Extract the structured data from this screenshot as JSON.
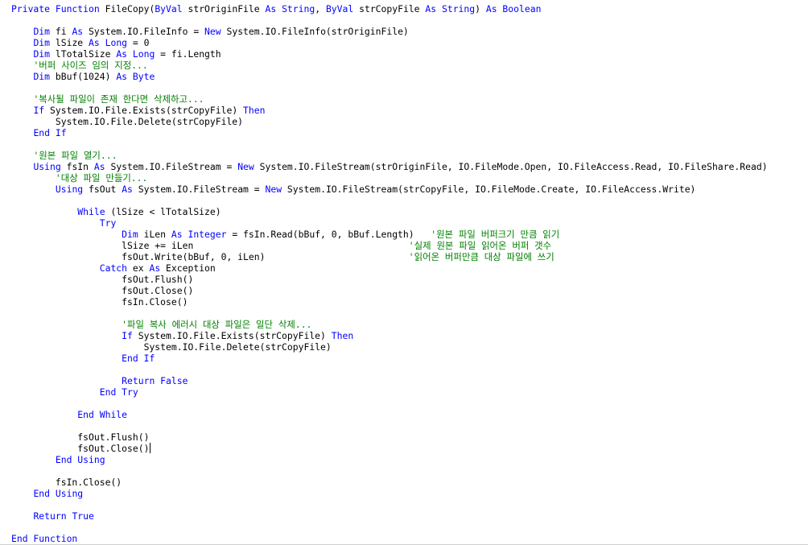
{
  "colors": {
    "keyword": "#0000ff",
    "comment": "#008000",
    "text": "#000000",
    "background": "#ffffff"
  },
  "editor": {
    "language": "Visual Basic .NET",
    "lines": [
      [
        {
          "k": "keyword",
          "t": "Private Function "
        },
        {
          "k": "text",
          "t": "FileCopy("
        },
        {
          "k": "keyword",
          "t": "ByVal"
        },
        {
          "k": "text",
          "t": " strOriginFile "
        },
        {
          "k": "keyword",
          "t": "As String"
        },
        {
          "k": "text",
          "t": ", "
        },
        {
          "k": "keyword",
          "t": "ByVal"
        },
        {
          "k": "text",
          "t": " strCopyFile "
        },
        {
          "k": "keyword",
          "t": "As String"
        },
        {
          "k": "text",
          "t": ") "
        },
        {
          "k": "keyword",
          "t": "As Boolean"
        }
      ],
      [],
      [
        {
          "k": "text",
          "t": "    "
        },
        {
          "k": "keyword",
          "t": "Dim"
        },
        {
          "k": "text",
          "t": " fi "
        },
        {
          "k": "keyword",
          "t": "As"
        },
        {
          "k": "text",
          "t": " System.IO.FileInfo = "
        },
        {
          "k": "keyword",
          "t": "New"
        },
        {
          "k": "text",
          "t": " System.IO.FileInfo(strOriginFile)"
        }
      ],
      [
        {
          "k": "text",
          "t": "    "
        },
        {
          "k": "keyword",
          "t": "Dim"
        },
        {
          "k": "text",
          "t": " lSize "
        },
        {
          "k": "keyword",
          "t": "As Long"
        },
        {
          "k": "text",
          "t": " = 0"
        }
      ],
      [
        {
          "k": "text",
          "t": "    "
        },
        {
          "k": "keyword",
          "t": "Dim"
        },
        {
          "k": "text",
          "t": " lTotalSize "
        },
        {
          "k": "keyword",
          "t": "As Long"
        },
        {
          "k": "text",
          "t": " = fi.Length"
        }
      ],
      [
        {
          "k": "text",
          "t": "    "
        },
        {
          "k": "comment",
          "t": "'버퍼 사이즈 임의 지정..."
        }
      ],
      [
        {
          "k": "text",
          "t": "    "
        },
        {
          "k": "keyword",
          "t": "Dim"
        },
        {
          "k": "text",
          "t": " bBuf(1024) "
        },
        {
          "k": "keyword",
          "t": "As Byte"
        }
      ],
      [],
      [
        {
          "k": "text",
          "t": "    "
        },
        {
          "k": "comment",
          "t": "'복사될 파일이 존재 한다면 삭제하고..."
        }
      ],
      [
        {
          "k": "text",
          "t": "    "
        },
        {
          "k": "keyword",
          "t": "If"
        },
        {
          "k": "text",
          "t": " System.IO.File.Exists(strCopyFile) "
        },
        {
          "k": "keyword",
          "t": "Then"
        }
      ],
      [
        {
          "k": "text",
          "t": "        System.IO.File.Delete(strCopyFile)"
        }
      ],
      [
        {
          "k": "text",
          "t": "    "
        },
        {
          "k": "keyword",
          "t": "End If"
        }
      ],
      [],
      [
        {
          "k": "text",
          "t": "    "
        },
        {
          "k": "comment",
          "t": "'원본 파일 열기..."
        }
      ],
      [
        {
          "k": "text",
          "t": "    "
        },
        {
          "k": "keyword",
          "t": "Using"
        },
        {
          "k": "text",
          "t": " fsIn "
        },
        {
          "k": "keyword",
          "t": "As"
        },
        {
          "k": "text",
          "t": " System.IO.FileStream = "
        },
        {
          "k": "keyword",
          "t": "New"
        },
        {
          "k": "text",
          "t": " System.IO.FileStream(strOriginFile, IO.FileMode.Open, IO.FileAccess.Read, IO.FileShare.Read)"
        }
      ],
      [
        {
          "k": "text",
          "t": "        "
        },
        {
          "k": "comment",
          "t": "'대상 파일 만들기..."
        }
      ],
      [
        {
          "k": "text",
          "t": "        "
        },
        {
          "k": "keyword",
          "t": "Using"
        },
        {
          "k": "text",
          "t": " fsOut "
        },
        {
          "k": "keyword",
          "t": "As"
        },
        {
          "k": "text",
          "t": " System.IO.FileStream = "
        },
        {
          "k": "keyword",
          "t": "New"
        },
        {
          "k": "text",
          "t": " System.IO.FileStream(strCopyFile, IO.FileMode.Create, IO.FileAccess.Write)"
        }
      ],
      [],
      [
        {
          "k": "text",
          "t": "            "
        },
        {
          "k": "keyword",
          "t": "While"
        },
        {
          "k": "text",
          "t": " (lSize < lTotalSize)"
        }
      ],
      [
        {
          "k": "text",
          "t": "                "
        },
        {
          "k": "keyword",
          "t": "Try"
        }
      ],
      [
        {
          "k": "text",
          "t": "                    "
        },
        {
          "k": "keyword",
          "t": "Dim"
        },
        {
          "k": "text",
          "t": " iLen "
        },
        {
          "k": "keyword",
          "t": "As Integer"
        },
        {
          "k": "text",
          "t": " = fsIn.Read(bBuf, 0, bBuf.Length)   "
        },
        {
          "k": "comment",
          "t": "'원본 파일 버퍼크기 만큼 읽기"
        }
      ],
      [
        {
          "k": "text",
          "t": "                    lSize += iLen                                       "
        },
        {
          "k": "comment",
          "t": "'실제 원본 파일 읽어온 버퍼 갯수"
        }
      ],
      [
        {
          "k": "text",
          "t": "                    fsOut.Write(bBuf, 0, iLen)                          "
        },
        {
          "k": "comment",
          "t": "'읽어온 버퍼만큼 대상 파일에 쓰기"
        }
      ],
      [
        {
          "k": "text",
          "t": "                "
        },
        {
          "k": "keyword",
          "t": "Catch"
        },
        {
          "k": "text",
          "t": " ex "
        },
        {
          "k": "keyword",
          "t": "As"
        },
        {
          "k": "text",
          "t": " Exception"
        }
      ],
      [
        {
          "k": "text",
          "t": "                    fsOut.Flush()"
        }
      ],
      [
        {
          "k": "text",
          "t": "                    fsOut.Close()"
        }
      ],
      [
        {
          "k": "text",
          "t": "                    fsIn.Close()"
        }
      ],
      [],
      [
        {
          "k": "text",
          "t": "                    "
        },
        {
          "k": "comment",
          "t": "'파일 복사 에러시 대상 파일은 일단 삭제..."
        }
      ],
      [
        {
          "k": "text",
          "t": "                    "
        },
        {
          "k": "keyword",
          "t": "If"
        },
        {
          "k": "text",
          "t": " System.IO.File.Exists(strCopyFile) "
        },
        {
          "k": "keyword",
          "t": "Then"
        }
      ],
      [
        {
          "k": "text",
          "t": "                        System.IO.File.Delete(strCopyFile)"
        }
      ],
      [
        {
          "k": "text",
          "t": "                    "
        },
        {
          "k": "keyword",
          "t": "End If"
        }
      ],
      [],
      [
        {
          "k": "text",
          "t": "                    "
        },
        {
          "k": "keyword",
          "t": "Return False"
        }
      ],
      [
        {
          "k": "text",
          "t": "                "
        },
        {
          "k": "keyword",
          "t": "End Try"
        }
      ],
      [],
      [
        {
          "k": "text",
          "t": "            "
        },
        {
          "k": "keyword",
          "t": "End While"
        }
      ],
      [],
      [
        {
          "k": "text",
          "t": "            fsOut.Flush()"
        }
      ],
      [
        {
          "k": "text",
          "t": "            fsOut.Close()"
        },
        {
          "k": "caret",
          "t": ""
        }
      ],
      [
        {
          "k": "text",
          "t": "        "
        },
        {
          "k": "keyword",
          "t": "End Using"
        }
      ],
      [],
      [
        {
          "k": "text",
          "t": "        fsIn.Close()"
        }
      ],
      [
        {
          "k": "text",
          "t": "    "
        },
        {
          "k": "keyword",
          "t": "End Using"
        }
      ],
      [],
      [
        {
          "k": "text",
          "t": "    "
        },
        {
          "k": "keyword",
          "t": "Return True"
        }
      ],
      [],
      [
        {
          "k": "keyword",
          "t": "End Function"
        }
      ]
    ]
  }
}
